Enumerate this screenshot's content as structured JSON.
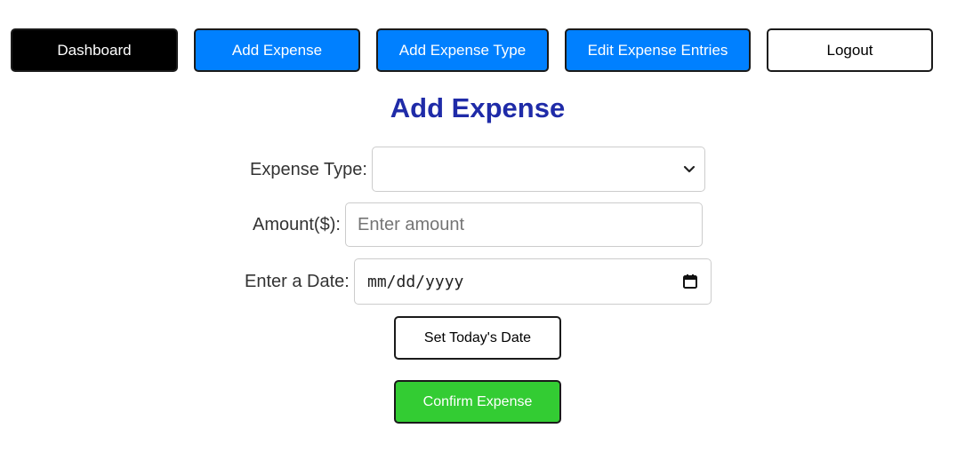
{
  "nav": {
    "dashboard": "Dashboard",
    "add_expense": "Add Expense",
    "add_expense_type": "Add Expense Type",
    "edit_expense_entries": "Edit Expense Entries",
    "logout": "Logout"
  },
  "page": {
    "title": "Add Expense"
  },
  "form": {
    "expense_type_label": "Expense Type:",
    "expense_type_value": "",
    "amount_label": "Amount($):",
    "amount_placeholder": "Enter amount",
    "date_label": "Enter a Date:",
    "date_placeholder": "mm/dd/yyyy",
    "set_today_label": "Set Today's Date",
    "confirm_label": "Confirm Expense"
  },
  "colors": {
    "title": "#1f2ba8",
    "nav_active": "#000000",
    "nav_primary": "#0080ff",
    "confirm": "#33cc33"
  },
  "icons": {
    "select_chevron": "chevron-down-icon",
    "date_picker": "calendar-icon"
  }
}
